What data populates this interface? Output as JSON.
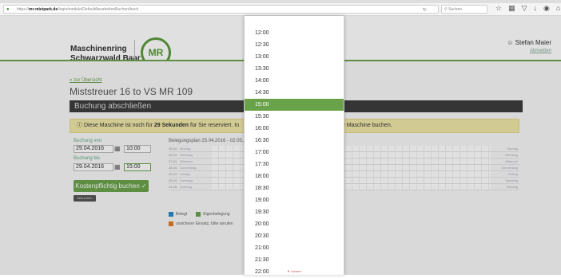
{
  "browser": {
    "url_host": "mr-mietpark.de",
    "url_prefix": "https://",
    "url_path": "/login/module/Default/bearbeitenBuchen/buch",
    "search_placeholder": "Suchen"
  },
  "header": {
    "brand_line1": "Maschinenring",
    "brand_line2": "Schwarzwald Baar",
    "logo_text": "MR",
    "user_name": "Stefan Maier",
    "logout_label": "Abmelden"
  },
  "page": {
    "back_link": "« zur Übersicht",
    "title": "Miststreuer 16 to VS MR 109",
    "section_title": "Buchung abschließen",
    "notice_prefix": "Diese Maschine ist noch für",
    "notice_bold": "29 Sekunden",
    "notice_mid": "für Sie reserviert. In",
    "notice_tail": "e Maschine buchen."
  },
  "form": {
    "from_label": "Buchung von",
    "from_date": "29.04.2016",
    "from_time": "10:00",
    "to_label": "Buchung bis",
    "to_date": "29.04.2016",
    "to_time": "15:00",
    "book_button": "Kostenpflichtig buchen",
    "cancel_button": "Abbrechen"
  },
  "plan": {
    "label": "Belegungsplan 25.04.2016 - 02.05.2",
    "days": [
      {
        "date": "25.04.",
        "weekday": "Montag"
      },
      {
        "date": "26.04.",
        "weekday": "Dienstag"
      },
      {
        "date": "27.04.",
        "weekday": "Mittwoch"
      },
      {
        "date": "28.04.",
        "weekday": "Donnerstag"
      },
      {
        "date": "29.04.",
        "weekday": "Freitag"
      },
      {
        "date": "30.04.",
        "weekday": "Samstag"
      },
      {
        "date": "01.05.",
        "weekday": "Sonntag"
      }
    ],
    "legend_busy": "Belegt",
    "legend_own": "Eigenbelegung",
    "legend_unsure": "unsicherer Einsatz, bitte anrufen",
    "legend_colors": {
      "busy": "#2a8ac6",
      "own": "#6aa24a",
      "unsure": "#e07a2a"
    }
  },
  "dropdown": {
    "items": [
      "12:00",
      "12:30",
      "13:00",
      "13:30",
      "14:00",
      "14:30",
      "15:00",
      "15:30",
      "16:00",
      "16:30",
      "17:00",
      "17:30",
      "18:00",
      "18:30",
      "19:00",
      "19:30",
      "20:00",
      "20:30",
      "21:00",
      "21:30",
      "22:00"
    ],
    "selected": "15:00",
    "footer": "▼ Unsere"
  },
  "colors": {
    "accent": "#6aa24a",
    "dark_bar": "#3d3d3d",
    "notice_bg": "#efe6a8"
  }
}
